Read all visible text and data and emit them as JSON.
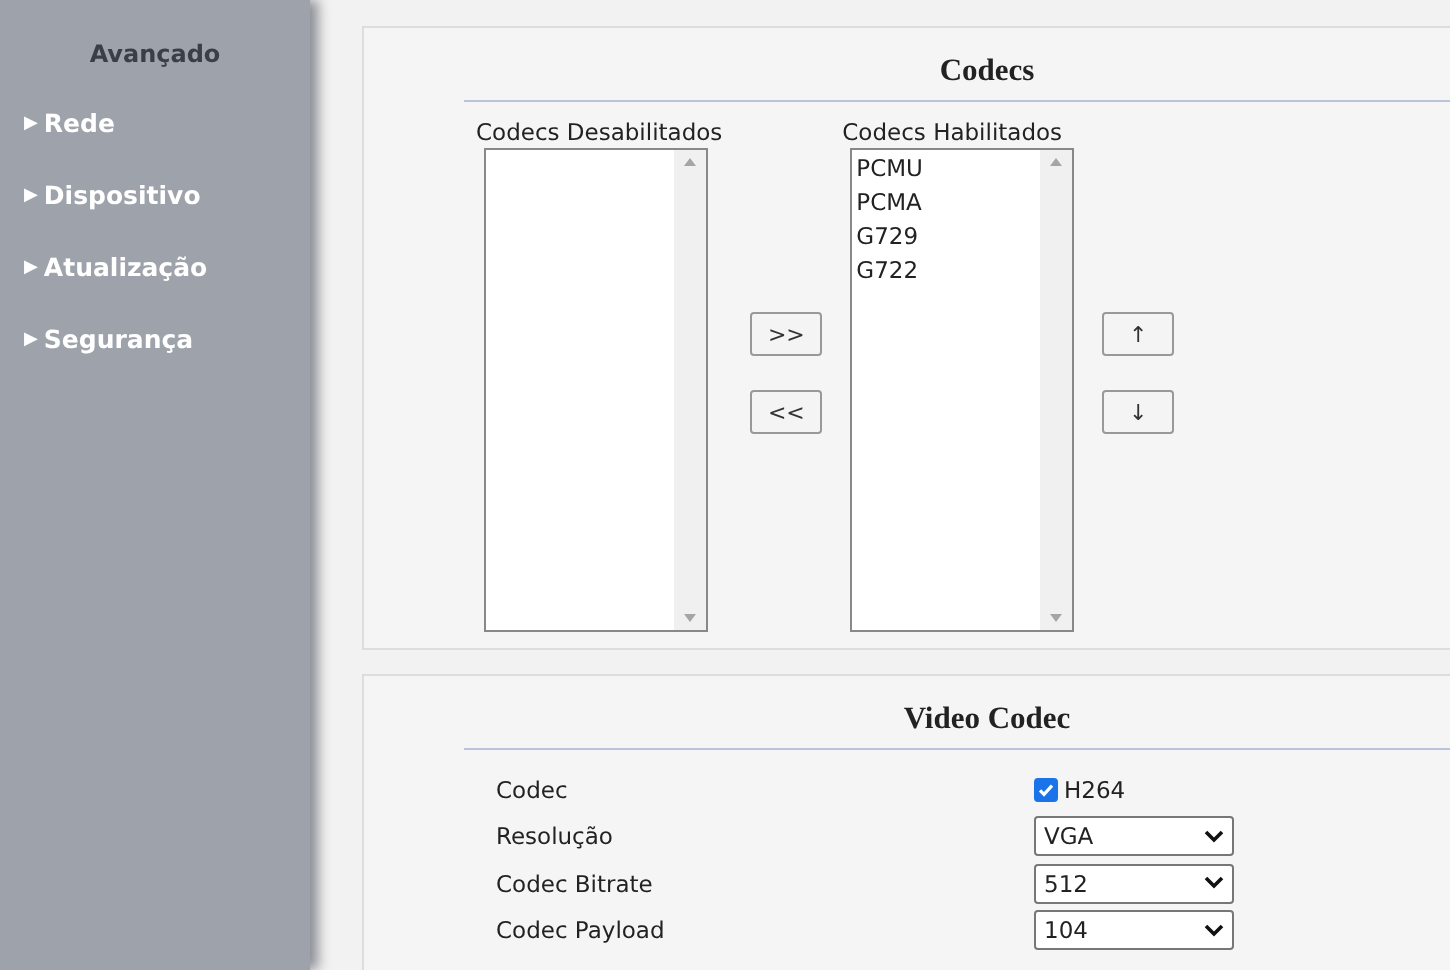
{
  "sidebar": {
    "title": "Avançado",
    "items": [
      {
        "arrow": "▶",
        "label": "Rede"
      },
      {
        "arrow": "▶",
        "label": "Dispositivo"
      },
      {
        "arrow": "▶",
        "label": "Atualização"
      },
      {
        "arrow": "▶",
        "label": "Segurança"
      }
    ]
  },
  "codecs": {
    "title": "Codecs",
    "disabled_label": "Codecs Desabilitados",
    "enabled_label": "Codecs Habilitados",
    "enabled": [
      "PCMU",
      "PCMA",
      "G729",
      "G722"
    ],
    "move_buttons": [
      ">>",
      "<<"
    ],
    "order_buttons": [
      "↑",
      "↓"
    ]
  },
  "video_codec": {
    "title": "Video Codec",
    "rows": [
      {
        "kind": "checkbox",
        "label": "Codec",
        "value": "H264",
        "checked": true
      },
      {
        "kind": "select",
        "label": "Resolução",
        "value": "VGA"
      },
      {
        "kind": "select",
        "label": "Codec Bitrate",
        "value": "512"
      },
      {
        "kind": "select",
        "label": "Codec Payload",
        "value": "104"
      }
    ]
  }
}
